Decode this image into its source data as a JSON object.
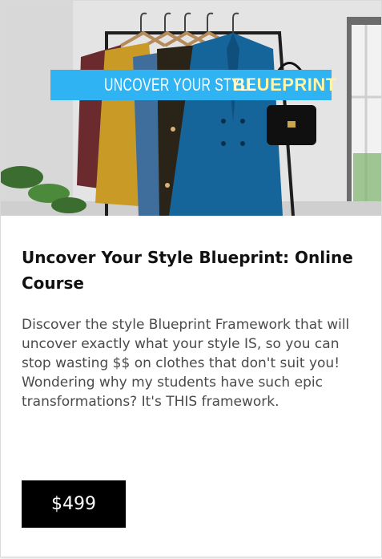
{
  "hero": {
    "banner_thin": "UNCOVER YOUR STYLE",
    "banner_bold": "BLUEPRINT",
    "banner_color": "#2fb3f2",
    "banner_bold_color": "#fff3a4"
  },
  "course": {
    "title": "Uncover Your Style Blueprint: Online Course",
    "description": "Discover the style Blueprint Framework that will uncover exactly what your style IS, so you can stop wasting $$ on clothes that don't suit you! Wondering why my students have such epic transformations? It's THIS framework.",
    "price": "$499"
  }
}
